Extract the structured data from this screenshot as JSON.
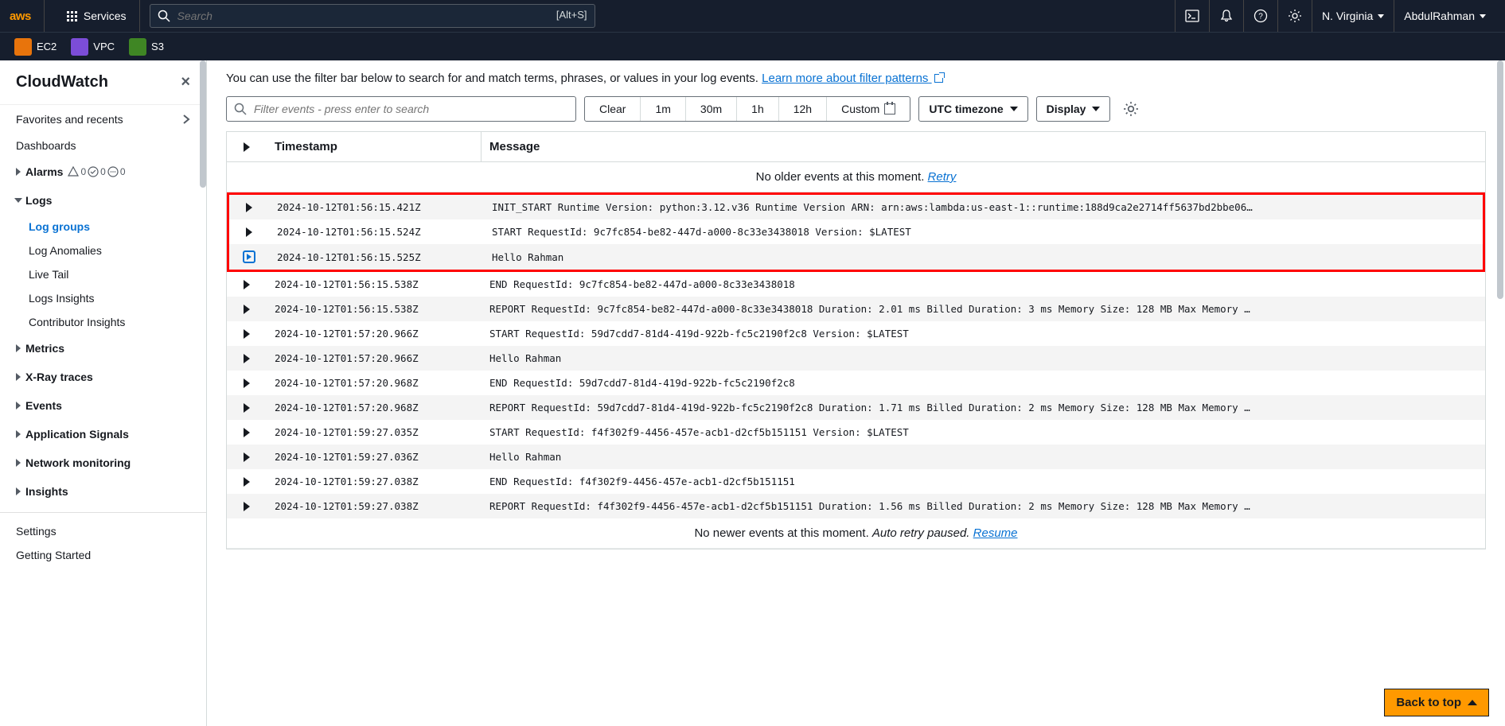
{
  "topbar": {
    "logo_text": "aws",
    "services_label": "Services",
    "search_placeholder": "Search",
    "search_shortcut": "[Alt+S]",
    "region": "N. Virginia",
    "user": "AbdulRahman"
  },
  "svc_bar": [
    {
      "abbr": "",
      "label": "EC2",
      "cls": "svc-ec2"
    },
    {
      "abbr": "",
      "label": "VPC",
      "cls": "svc-vpc"
    },
    {
      "abbr": "",
      "label": "S3",
      "cls": "svc-s3"
    }
  ],
  "sidebar": {
    "title": "CloudWatch",
    "favorites": "Favorites and recents",
    "dashboards": "Dashboards",
    "alarms": {
      "label": "Alarms",
      "warn": "0",
      "ok": "0",
      "dots": "0"
    },
    "logs": {
      "label": "Logs",
      "items": [
        "Log groups",
        "Log Anomalies",
        "Live Tail",
        "Logs Insights",
        "Contributor Insights"
      ],
      "active": 0
    },
    "collapsed": [
      "Metrics",
      "X-Ray traces",
      "Events",
      "Application Signals",
      "Network monitoring",
      "Insights"
    ],
    "bottom": [
      "Settings",
      "Getting Started"
    ]
  },
  "main": {
    "hint_text": "You can use the filter bar below to search for and match terms, phrases, or values in your log events. ",
    "hint_link": "Learn more about filter patterns",
    "filter_placeholder": "Filter events - press enter to search",
    "time_buttons": [
      "Clear",
      "1m",
      "30m",
      "1h",
      "12h"
    ],
    "custom_label": "Custom",
    "timezone_label": "UTC timezone",
    "display_label": "Display",
    "table_headers": {
      "timestamp": "Timestamp",
      "message": "Message"
    },
    "no_older": "No older events at this moment. ",
    "retry": "Retry",
    "no_newer": "No newer events at this moment. ",
    "auto_retry_paused": "Auto retry paused. ",
    "resume": "Resume",
    "rows": [
      {
        "ts": "2024-10-12T01:56:15.421Z",
        "msg": "INIT_START Runtime Version: python:3.12.v36 Runtime Version ARN: arn:aws:lambda:us-east-1::runtime:188d9ca2e2714ff5637bd2bbe06…",
        "hl": true
      },
      {
        "ts": "2024-10-12T01:56:15.524Z",
        "msg": "START RequestId: 9c7fc854-be82-447d-a000-8c33e3438018 Version: $LATEST",
        "hl": true
      },
      {
        "ts": "2024-10-12T01:56:15.525Z",
        "msg": "Hello Rahman",
        "hl": true,
        "selected": true
      },
      {
        "ts": "2024-10-12T01:56:15.538Z",
        "msg": "END RequestId: 9c7fc854-be82-447d-a000-8c33e3438018"
      },
      {
        "ts": "2024-10-12T01:56:15.538Z",
        "msg": "REPORT RequestId: 9c7fc854-be82-447d-a000-8c33e3438018 Duration: 2.01 ms Billed Duration: 3 ms Memory Size: 128 MB Max Memory …"
      },
      {
        "ts": "2024-10-12T01:57:20.966Z",
        "msg": "START RequestId: 59d7cdd7-81d4-419d-922b-fc5c2190f2c8 Version: $LATEST"
      },
      {
        "ts": "2024-10-12T01:57:20.966Z",
        "msg": "Hello Rahman"
      },
      {
        "ts": "2024-10-12T01:57:20.968Z",
        "msg": "END RequestId: 59d7cdd7-81d4-419d-922b-fc5c2190f2c8"
      },
      {
        "ts": "2024-10-12T01:57:20.968Z",
        "msg": "REPORT RequestId: 59d7cdd7-81d4-419d-922b-fc5c2190f2c8 Duration: 1.71 ms Billed Duration: 2 ms Memory Size: 128 MB Max Memory …"
      },
      {
        "ts": "2024-10-12T01:59:27.035Z",
        "msg": "START RequestId: f4f302f9-4456-457e-acb1-d2cf5b151151 Version: $LATEST"
      },
      {
        "ts": "2024-10-12T01:59:27.036Z",
        "msg": "Hello Rahman"
      },
      {
        "ts": "2024-10-12T01:59:27.038Z",
        "msg": "END RequestId: f4f302f9-4456-457e-acb1-d2cf5b151151"
      },
      {
        "ts": "2024-10-12T01:59:27.038Z",
        "msg": "REPORT RequestId: f4f302f9-4456-457e-acb1-d2cf5b151151 Duration: 1.56 ms Billed Duration: 2 ms Memory Size: 128 MB Max Memory …"
      }
    ]
  },
  "back_to_top": "Back to top"
}
